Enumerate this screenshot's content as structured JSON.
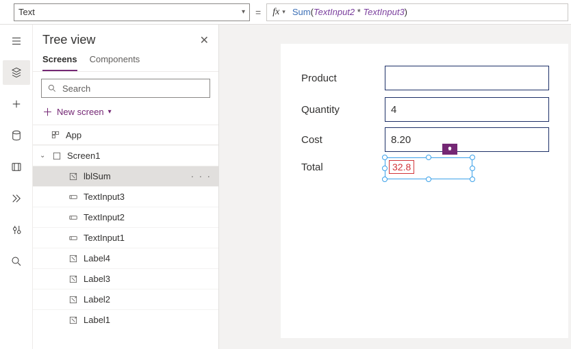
{
  "property_dropdown": "Text",
  "equals": "=",
  "fx": "fx",
  "formula": {
    "fn": "Sum",
    "lp": "(",
    "a": "TextInput2",
    "op": " * ",
    "b": "TextInput3",
    "rp": ")"
  },
  "panel": {
    "title": "Tree view",
    "tabs": {
      "screens": "Screens",
      "components": "Components"
    },
    "search_placeholder": "Search",
    "new_screen": "New screen"
  },
  "tree": {
    "app": "App",
    "screen": "Screen1",
    "children": [
      {
        "name": "lblSum",
        "kind": "label",
        "selected": true
      },
      {
        "name": "TextInput3",
        "kind": "textinput"
      },
      {
        "name": "TextInput2",
        "kind": "textinput"
      },
      {
        "name": "TextInput1",
        "kind": "textinput"
      },
      {
        "name": "Label4",
        "kind": "label"
      },
      {
        "name": "Label3",
        "kind": "label"
      },
      {
        "name": "Label2",
        "kind": "label"
      },
      {
        "name": "Label1",
        "kind": "label"
      }
    ],
    "more": "· · ·"
  },
  "form": {
    "product": {
      "label": "Product",
      "value": ""
    },
    "quantity": {
      "label": "Quantity",
      "value": "4"
    },
    "cost": {
      "label": "Cost",
      "value": "8.20"
    },
    "total": {
      "label": "Total",
      "value": "32.8"
    }
  }
}
